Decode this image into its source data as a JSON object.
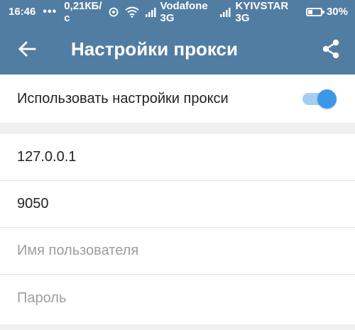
{
  "status_bar": {
    "time": "16:46",
    "notifications": "•••",
    "speed": "0,21КБ/с",
    "carrier1": "Vodafone 3G",
    "carrier2": "KYIVSTAR 3G",
    "battery": "30%",
    "battery_level": 0.3,
    "icons": [
      "sync-icon",
      "wifi-icon",
      "signal-icon",
      "signal-icon",
      "battery-icon"
    ]
  },
  "toolbar": {
    "title": "Настройки прокси",
    "back_icon": "arrow-back-icon",
    "share_icon": "share-icon"
  },
  "proxy_toggle": {
    "label": "Использовать настройки прокси",
    "enabled": true
  },
  "fields": {
    "server": {
      "value": "127.0.0.1",
      "placeholder": ""
    },
    "port": {
      "value": "9050",
      "placeholder": ""
    },
    "username": {
      "value": "",
      "placeholder": "Имя пользователя"
    },
    "password": {
      "value": "",
      "placeholder": "Пароль"
    }
  },
  "colors": {
    "header": "#527da3",
    "switch_thumb": "#3d97e8",
    "switch_track": "#a5cdf0",
    "background": "#f0f0f0"
  }
}
